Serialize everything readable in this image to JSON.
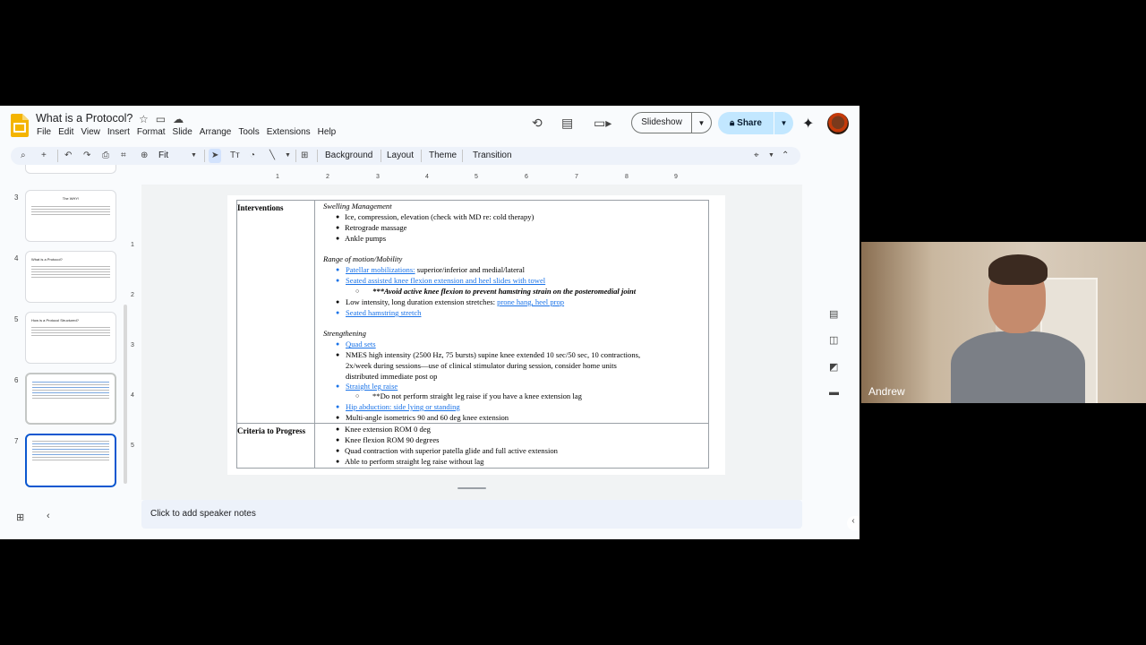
{
  "app": {
    "title": "What is a Protocol?",
    "menu": [
      "File",
      "Edit",
      "View",
      "Insert",
      "Format",
      "Slide",
      "Arrange",
      "Tools",
      "Extensions",
      "Help"
    ],
    "slideshow_label": "Slideshow",
    "share_label": "Share",
    "toolbar": {
      "zoom": "Fit",
      "background": "Background",
      "layout": "Layout",
      "theme": "Theme",
      "transition": "Transition"
    },
    "notes_placeholder": "Click to add speaker notes"
  },
  "filmstrip": {
    "slides": [
      {
        "num": "3",
        "title": "The WHY!"
      },
      {
        "num": "4",
        "title": "What is a Protocol?"
      },
      {
        "num": "5",
        "title": "How is a Protocol Structured?"
      },
      {
        "num": "6",
        "title": ""
      },
      {
        "num": "7",
        "title": ""
      }
    ]
  },
  "ruler": {
    "h": [
      "1",
      "2",
      "3",
      "4",
      "5",
      "6",
      "7",
      "8",
      "9"
    ],
    "v": [
      "1",
      "2",
      "3",
      "4",
      "5"
    ]
  },
  "slide": {
    "row1_header": "Interventions",
    "swelling_heading": "Swelling Management",
    "swelling_items": [
      "Ice, compression, elevation (check with MD re: cold therapy)",
      "Retrograde massage",
      "Ankle pumps"
    ],
    "rom_heading": "Range of motion/Mobility",
    "rom_1_link": "Patellar mobilizations:",
    "rom_1_rest": " superior/inferior and medial/lateral",
    "rom_2_link": "Seated assisted knee flexion extension and heel slides with towel",
    "rom_2_sub": "***Avoid active knee flexion to prevent hamstring strain on the posteromedial joint",
    "rom_3_text": "Low intensity, long duration extension stretches: ",
    "rom_3_link": "prone hang, heel prop",
    "rom_4_link": "Seated hamstring stretch",
    "str_heading": "Strengthening",
    "str_1_link": "Quad sets",
    "str_2_l1": "NMES high intensity (2500 Hz, 75 bursts) supine knee extended 10 sec/50 sec, 10 contractions,",
    "str_2_l2": "2x/week during sessions—use of clinical stimulator during session, consider home units",
    "str_2_l3": "distributed immediate post op",
    "str_3_link": "Straight leg raise",
    "str_3_sub": "**Do not perform straight leg raise if you have a knee extension lag",
    "str_4_link": "Hip abduction: side lying or standing",
    "str_5": "Multi-angle isometrics 90 and 60 deg knee extension",
    "row2_header": "Criteria to Progress",
    "criteria": [
      "Knee extension ROM 0 deg",
      "Knee flexion ROM 90 degrees",
      "Quad contraction with superior patella glide and full active extension",
      "Able to perform straight leg raise without lag"
    ]
  },
  "video": {
    "name": "Andrew"
  }
}
